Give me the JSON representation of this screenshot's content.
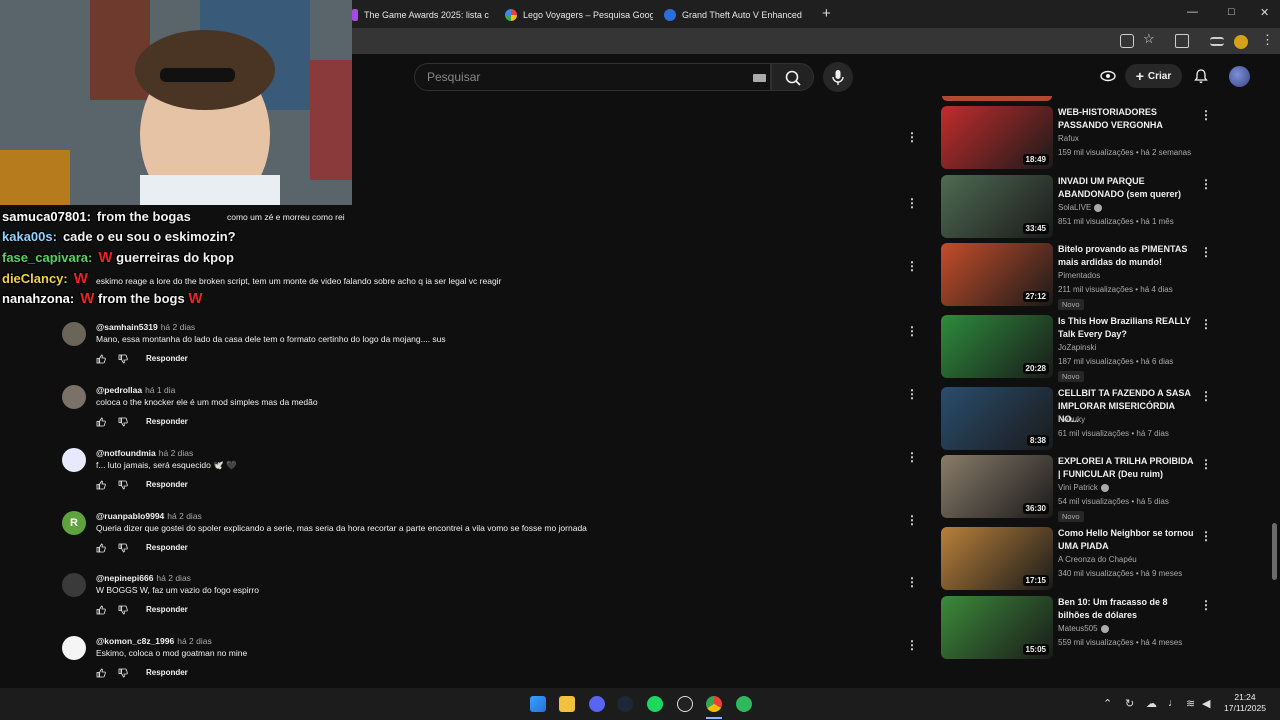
{
  "browser": {
    "tabs": [
      {
        "title": "The Game Awards 2025: lista c",
        "color": "#a14de0"
      },
      {
        "title": "Lego Voyagers – Pesquisa Goog",
        "color": "#ffffff"
      },
      {
        "title": "Grand Theft Auto V Enhanced",
        "color": "#2a6fd9"
      }
    ],
    "new_tab": "+",
    "min": "—",
    "max": "□",
    "close": "✕"
  },
  "youtube": {
    "search_placeholder": "Pesquisar",
    "create_label": "Criar"
  },
  "stream_chat": [
    {
      "user": "samuca07801:",
      "text": "from the bogas",
      "color": "#ffffff"
    },
    {
      "user": "kaka00s:",
      "text": "cade o eu sou o eskimozin?",
      "color": "#8fd3ff"
    },
    {
      "user": "fase_capivara:",
      "text": "guerreiras do kpop",
      "color": "#56d364"
    },
    {
      "user": "dieClancy:",
      "text": "",
      "color": "#f2d14b"
    },
    {
      "user": "nanahzona:",
      "text": "from the bogs",
      "color": "#ffffff"
    }
  ],
  "comments_partial": [
    {
      "text": "como um zé e morreu como rei"
    },
    {
      "text": "eskimo reage a lore do the broken script, tem um monte de video falando sobre acho q ia ser legal vc reagir"
    }
  ],
  "comments": [
    {
      "user": "@samhain5319",
      "time": "há 2 dias",
      "text": "Mano, essa montanha do lado da casa dele tem o formato certinho do logo da mojang.... sus",
      "avatar": "#6b6559",
      "initial": ""
    },
    {
      "user": "@pedrollaa",
      "time": "há 1 dia",
      "text": "coloca o the knocker ele é um mod simples mas da medão",
      "avatar": "#7a7268",
      "initial": ""
    },
    {
      "user": "@notfoundmia",
      "time": "há 2 dias",
      "text": "f... luto jamais, será esquecido 🕊️ 🖤",
      "avatar": "#e8e8ff",
      "initial": ""
    },
    {
      "user": "@ruanpablo9994",
      "time": "há 2 dias",
      "text": "Queria dizer que gostei do spoler explicando a serie, mas seria da hora recortar a parte encontrei a vila vomo se fosse mo jornada",
      "avatar": "#5fa33e",
      "initial": "R"
    },
    {
      "user": "@nepinepi666",
      "time": "há 2 dias",
      "text": "W BOGGS W, faz um vazio do fogo espirro",
      "avatar": "#3a3a3a",
      "initial": ""
    },
    {
      "user": "@komon_c8z_1996",
      "time": "há 2 dias",
      "text": "Eskimo, coloca o mod goatman no mine",
      "avatar": "#f5f5f5",
      "initial": ""
    }
  ],
  "reply_label": "Responder",
  "recommendations": [
    {
      "title": "WEB-HISTORIADORES PASSANDO VERGONHA",
      "channel": "Rafux",
      "verified": false,
      "meta": "159 mil visualizações • há 2 semanas",
      "duration": "18:49",
      "new": "",
      "thumb": "#c22c2c"
    },
    {
      "title": "INVADI UM PARQUE ABANDONADO (sem querer)",
      "channel": "SolaLIVE",
      "verified": true,
      "meta": "851 mil visualizações • há 1 mês",
      "duration": "33:45",
      "new": "",
      "thumb": "#4f6b52"
    },
    {
      "title": "Bitelo provando as PIMENTAS mais ardidas do mundo!",
      "channel": "Pimentados",
      "verified": false,
      "meta": "211 mil visualizações • há 4 dias",
      "duration": "27:12",
      "new": "Novo",
      "thumb": "#c44d2a"
    },
    {
      "title": "Is This How Brazilians REALLY Talk Every Day?",
      "channel": "JoZapinski",
      "verified": false,
      "meta": "187 mil visualizações • há 6 dias",
      "duration": "20:28",
      "new": "Novo",
      "thumb": "#2c8c3c"
    },
    {
      "title": "CELLBIT TA FAZENDO A SASA IMPLORAR MISERICÓRDIA NO...",
      "channel": "Nobuky",
      "verified": false,
      "meta": "61 mil visualizações • há 7 dias",
      "duration": "8:38",
      "new": "",
      "thumb": "#2a4d6e"
    },
    {
      "title": "EXPLOREI A TRILHA PROIBIDA | FUNICULAR (Deu ruim)",
      "channel": "Vini Patrick",
      "verified": true,
      "meta": "54 mil visualizações • há 5 dias",
      "duration": "36:30",
      "new": "Novo",
      "thumb": "#8a7c6a"
    },
    {
      "title": "Como Hello Neighbor se tornou UMA PIADA",
      "channel": "A Creonza do Chapéu",
      "verified": false,
      "meta": "340 mil visualizações • há 9 meses",
      "duration": "17:15",
      "new": "",
      "thumb": "#b8803a"
    },
    {
      "title": "Ben 10: Um fracasso de 8 bilhões de dólares",
      "channel": "Mateus505",
      "verified": true,
      "meta": "559 mil visualizações • há 4 meses",
      "duration": "15:05",
      "new": "",
      "thumb": "#3c8a3a"
    }
  ],
  "taskbar": {
    "time": "21:24",
    "date": "17/11/2025"
  }
}
